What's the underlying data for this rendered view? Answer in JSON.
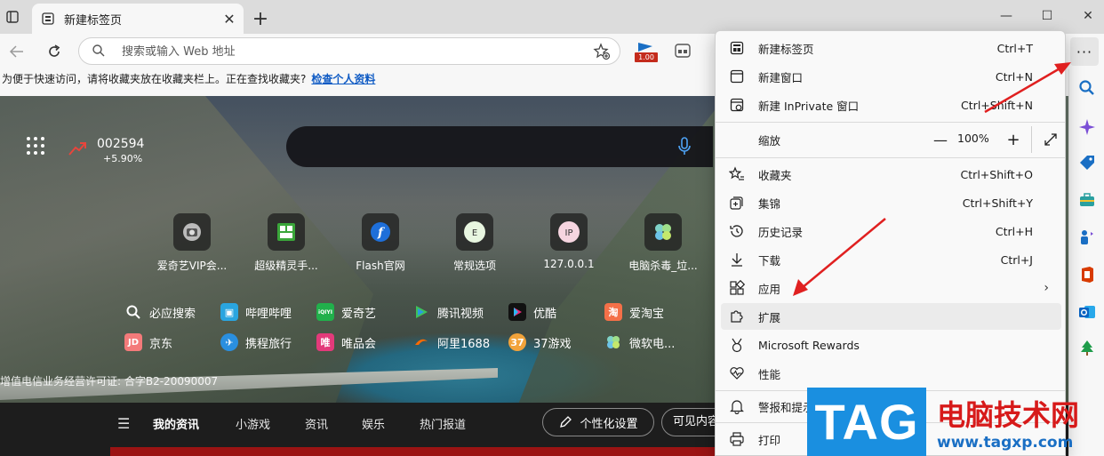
{
  "tab": {
    "title": "新建标签页",
    "close": "✕"
  },
  "window": {
    "minimize": "—",
    "maximize": "☐",
    "close": "✕"
  },
  "address": {
    "placeholder": "搜索或输入 Web 地址"
  },
  "extension_badge": "1.00",
  "more_button": "···",
  "favorites_bar": {
    "message": "为便于快速访问，请将收藏夹放在收藏夹栏上。正在查找收藏夹?",
    "link": "检查个人资料"
  },
  "stock": {
    "code": "002594",
    "change": "+5.90%"
  },
  "tiles": [
    {
      "label": "爱奇艺VIP会..."
    },
    {
      "label": "超级精灵手..."
    },
    {
      "label": "Flash官网"
    },
    {
      "label": "常规选项",
      "glyph": "E"
    },
    {
      "label": "127.0.0.1",
      "glyph": "IP"
    },
    {
      "label": "电脑杀毒_垃..."
    }
  ],
  "quick_links": [
    {
      "label": "必应搜索"
    },
    {
      "label": "哔哩哔哩"
    },
    {
      "label": "爱奇艺",
      "glyph": "iQIYI"
    },
    {
      "label": "腾讯视频"
    },
    {
      "label": "优酷"
    },
    {
      "label": "爱淘宝",
      "glyph": "淘"
    },
    {
      "label": "京东",
      "glyph": "JD"
    },
    {
      "label": "携程旅行"
    },
    {
      "label": "唯品会",
      "glyph": "唯"
    },
    {
      "label": "阿里1688"
    },
    {
      "label": "37游戏"
    },
    {
      "label": "微软电..."
    }
  ],
  "icp_text": "增值电信业务经营许可证: 合字B2-20090007",
  "news_nav": {
    "menu_icon": "☰",
    "items": [
      "我的资讯",
      "小游戏",
      "资讯",
      "娱乐",
      "热门报道"
    ],
    "personalize": "个性化设置",
    "visible": "可见内容"
  },
  "menu": {
    "new_tab": {
      "label": "新建标签页",
      "shortcut": "Ctrl+T"
    },
    "new_window": {
      "label": "新建窗口",
      "shortcut": "Ctrl+N"
    },
    "new_inprivate": {
      "label": "新建 InPrivate 窗口",
      "shortcut": "Ctrl+Shift+N"
    },
    "zoom": {
      "label": "缩放",
      "value": "100%",
      "minus": "—",
      "plus": "+"
    },
    "favorites": {
      "label": "收藏夹",
      "shortcut": "Ctrl+Shift+O"
    },
    "collections": {
      "label": "集锦",
      "shortcut": "Ctrl+Shift+Y"
    },
    "history": {
      "label": "历史记录",
      "shortcut": "Ctrl+H"
    },
    "downloads": {
      "label": "下载",
      "shortcut": "Ctrl+J"
    },
    "apps": {
      "label": "应用",
      "arrow": "›"
    },
    "extensions": {
      "label": "扩展"
    },
    "rewards": {
      "label": "Microsoft Rewards"
    },
    "performance": {
      "label": "性能"
    },
    "alerts": {
      "label": "警报和提示"
    },
    "print": {
      "label": "打印"
    }
  },
  "watermark": {
    "tag": "TAG",
    "title": "电脑技术网",
    "url": "www.tagxp.com"
  },
  "colors": {
    "accent": "#0f5bc4",
    "arrow": "#e02020",
    "watermark_blue": "#1a8fe0",
    "watermark_red": "#d71a1a"
  }
}
